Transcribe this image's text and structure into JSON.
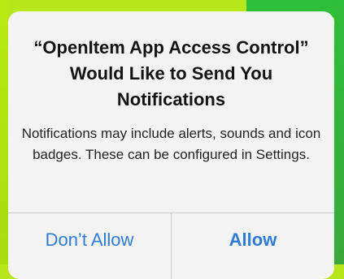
{
  "alert": {
    "title": "“OpenItem App Access Control” Would Like to Send You Notifications",
    "message": "Notifications may include alerts, sounds and icon badges. These can be configured in Settings.",
    "buttons": {
      "dont_allow": "Don’t Allow",
      "allow": "Allow"
    }
  },
  "colors": {
    "accent": "#2f7bd6",
    "alert_bg": "#f3f3f3",
    "background_left": "#b7e61a",
    "background_right": "#2fbf3a"
  }
}
